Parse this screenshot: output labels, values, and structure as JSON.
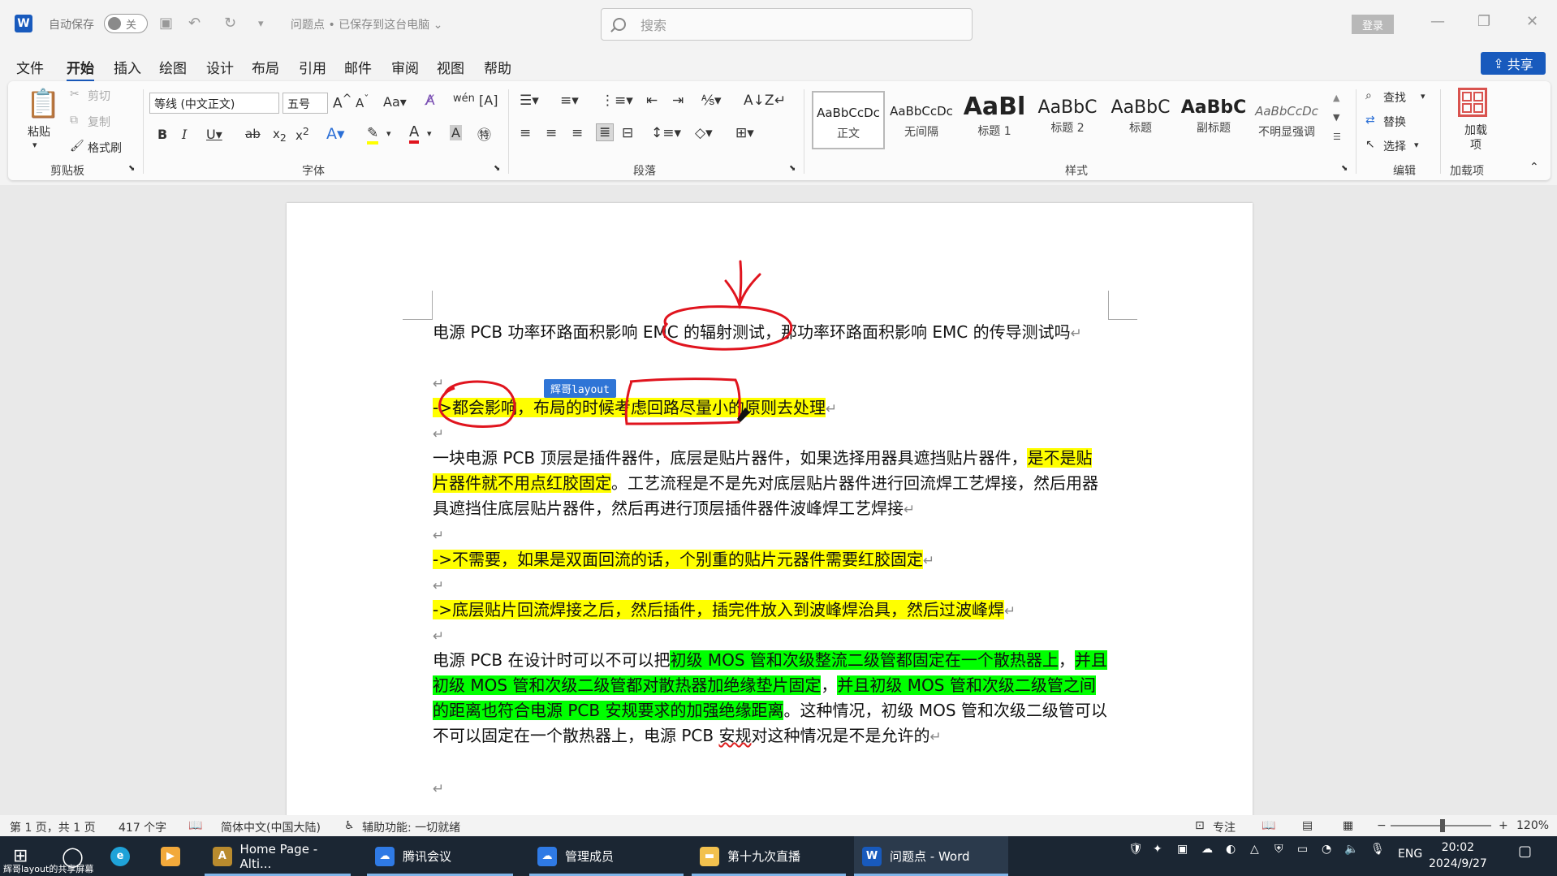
{
  "titlebar": {
    "autosave_label": "自动保存",
    "autosave_state": "关",
    "doc_title": "问题点 • 已保存到这台电脑 ⌄",
    "search_placeholder": "搜索",
    "login_label": "登录"
  },
  "menu": {
    "tabs": [
      "文件",
      "开始",
      "插入",
      "绘图",
      "设计",
      "布局",
      "引用",
      "邮件",
      "审阅",
      "视图",
      "帮助"
    ],
    "active": "开始",
    "share_label": "共享"
  },
  "ribbon": {
    "clipboard": {
      "paste": "粘贴",
      "cut": "剪切",
      "copy": "复制",
      "format_painter": "格式刷",
      "label": "剪贴板"
    },
    "font": {
      "font_name": "等线 (中文正文)",
      "font_size": "五号",
      "label": "字体"
    },
    "paragraph": {
      "label": "段落"
    },
    "styles": {
      "label": "样式",
      "items": [
        {
          "sample": "AaBbCcDc",
          "name": "正文"
        },
        {
          "sample": "AaBbCcDc",
          "name": "无间隔"
        },
        {
          "sample": "AaBl",
          "name": "标题 1"
        },
        {
          "sample": "AaBbC",
          "name": "标题 2"
        },
        {
          "sample": "AaBbC",
          "name": "标题"
        },
        {
          "sample": "AaBbC",
          "name": "副标题"
        },
        {
          "sample": "AaBbCcDc",
          "name": "不明显强调"
        }
      ]
    },
    "editing": {
      "find": "查找",
      "replace": "替换",
      "select": "选择",
      "label": "编辑"
    },
    "addins": {
      "button": "加载项",
      "label": "加载项"
    }
  },
  "document": {
    "comment_tag": "辉哥layout",
    "p1": "电源 PCB 功率环路面积影响 EMC 的辐射测试，那功率环路面积影响 EMC 的传导测试吗",
    "p2": "->都会影响，布局的时候考虑回路尽量小的原则去处理",
    "p3_plain": "一块电源 PCB 顶层是插件器件，底层是贴片器件，如果选择用器具遮挡贴片器件，",
    "p3_hl": "是不是贴片器件就不用点红胶固定",
    "p3_rest": "。工艺流程是不是先对底层贴片器件进行回流焊工艺焊接，然后用器具遮挡住底层贴片器件，然后再进行顶层插件器件波峰焊工艺焊接",
    "p4": "->不需要，如果是双面回流的话，个别重的贴片元器件需要红胶固定",
    "p5": "->底层贴片回流焊接之后，然后插件，插完件放入到波峰焊治具，然后过波峰焊",
    "p6_a": "电源 PCB 在设计时可以不可以把",
    "p6_hl1": "初级 MOS 管和次级整流二级管都固定在一个散热器上",
    "p6_b": "，",
    "p6_hl2": "并且初级 MOS 管和次级二级管都对散热器加绝缘垫片固定",
    "p6_c": "，",
    "p6_hl3": "并且初级 MOS 管和次级二级管之间的距离也符合电源 PCB 安规要求的加强绝缘距离",
    "p6_d": "。这种情况，初级 MOS 管和次级二级管可以不可以固定在一个散热器上，电源 PCB ",
    "p6_sq": "安规",
    "p6_e": "对这种情况是不是允许的"
  },
  "statusbar": {
    "page": "第 1 页，共 1 页",
    "words": "417 个字",
    "language": "简体中文(中国大陆)",
    "accessibility": "辅助功能: 一切就绪",
    "focus": "专注",
    "zoom": "120%"
  },
  "taskbar": {
    "apps": [
      "Home Page - Alti...",
      "腾讯会议",
      "管理成员",
      "第十九次直播",
      "问题点 - Word"
    ],
    "lang": "ENG",
    "time": "20:02",
    "date": "2024/9/27",
    "caption": "辉哥layout的共享屏幕"
  },
  "colors": {
    "accent": "#185abd",
    "highlight_yellow": "#ffff00",
    "highlight_green": "#00ff00",
    "annotation_red": "#e0141e",
    "taskbar": "#1b2633"
  }
}
